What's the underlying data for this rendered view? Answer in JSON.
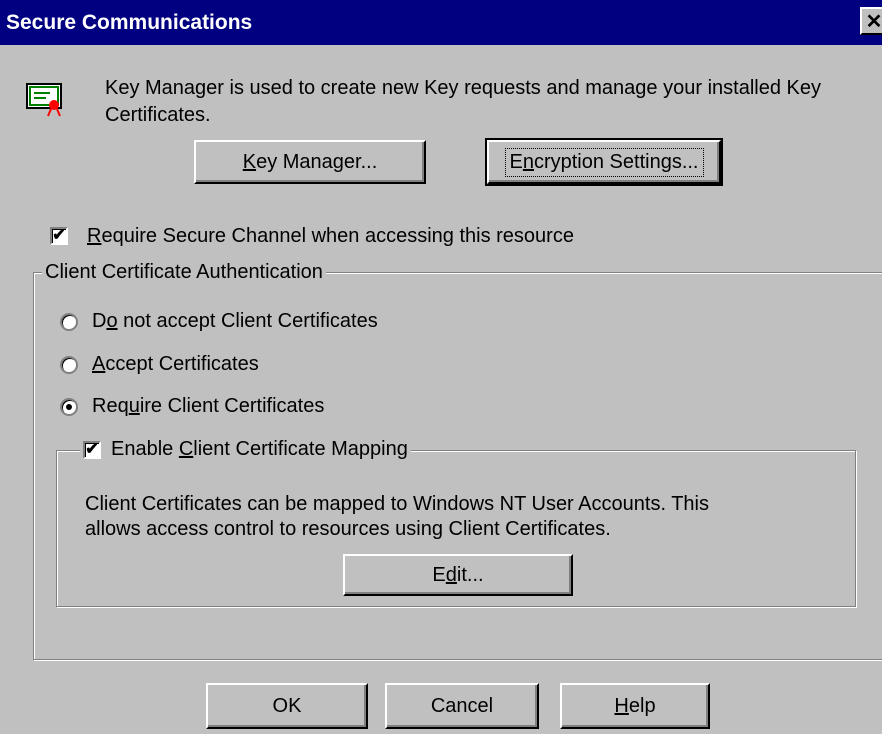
{
  "window": {
    "title": "Secure Communications",
    "close_glyph": "✕"
  },
  "intro": {
    "icon": "certificate-icon",
    "text": "Key Manager is used to create new Key requests and manage your installed Key Certificates."
  },
  "buttons": {
    "key_manager": {
      "accel": "K",
      "rest": "ey Manager..."
    },
    "encryption": {
      "pre": "E",
      "accel": "n",
      "rest": "cryption Settings..."
    }
  },
  "secure_channel": {
    "checked": true,
    "accel": "R",
    "rest": "equire Secure Channel when accessing this resource"
  },
  "client_auth": {
    "legend": "Client Certificate Authentication",
    "options": [
      {
        "pre": "D",
        "accel": "o",
        "rest": " not accept Client Certificates",
        "selected": false
      },
      {
        "pre": "",
        "accel": "A",
        "rest": "ccept Certificates",
        "selected": false
      },
      {
        "pre": "Req",
        "accel": "u",
        "rest": "ire Client Certificates",
        "selected": true
      }
    ]
  },
  "mapping": {
    "checked": true,
    "pre": "Enable ",
    "accel": "C",
    "rest": "lient Certificate Mapping",
    "description_line1": "Client Certificates can be mapped to Windows NT User Accounts.  This",
    "description_line2": "allows access control to resources using Client Certificates.",
    "edit": {
      "pre": "E",
      "accel": "d",
      "rest": "it..."
    }
  },
  "footer": {
    "ok": "OK",
    "cancel": "Cancel",
    "help": {
      "accel": "H",
      "rest": "elp"
    }
  },
  "check_glyph": "✔",
  "colors": {
    "titlebar": "#000080",
    "face": "#c0c0c0"
  }
}
